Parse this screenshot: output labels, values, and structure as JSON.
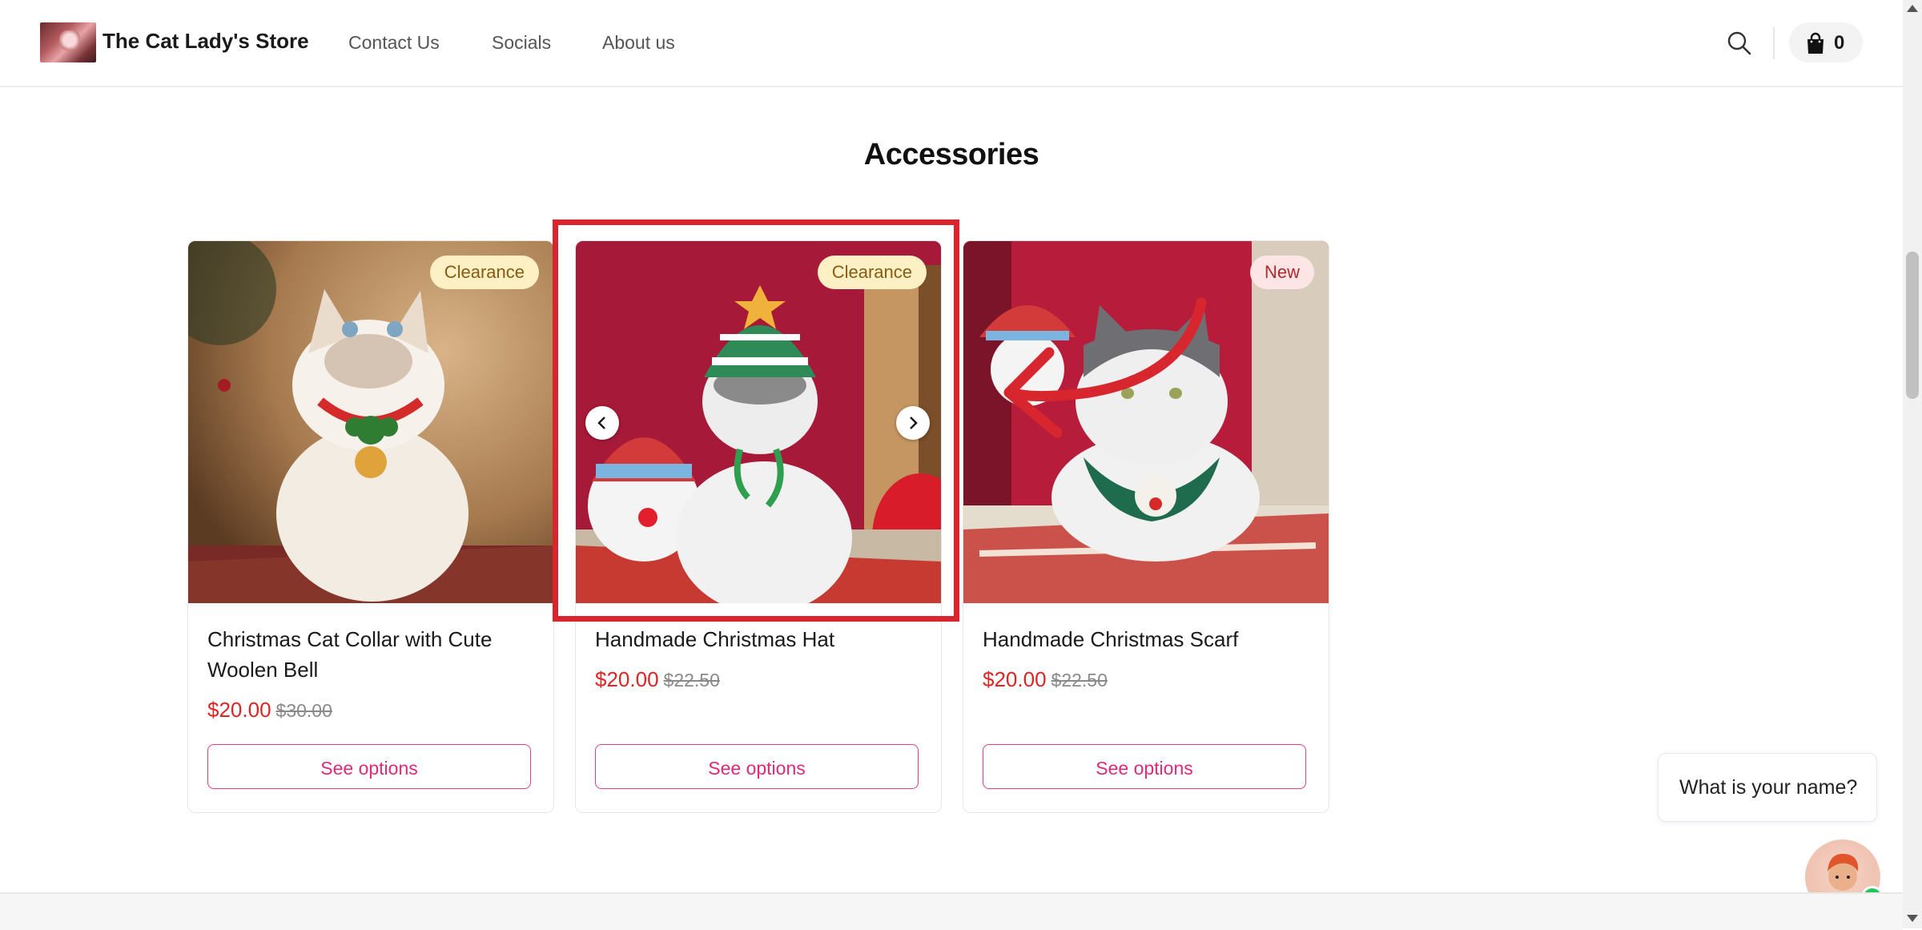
{
  "header": {
    "store_name": "The Cat Lady's Store",
    "nav": [
      "Contact Us",
      "Socials",
      "About us"
    ],
    "cart_count": "0",
    "icons": [
      "search-icon",
      "shopping-bag-icon"
    ]
  },
  "section": {
    "title": "Accessories"
  },
  "products": [
    {
      "badge": "Clearance",
      "title": "Christmas Cat Collar with Cute Woolen Bell",
      "price": "$20.00",
      "old_price": "$30.00",
      "button": "See options"
    },
    {
      "badge": "Clearance",
      "title": "Handmade Christmas Hat",
      "price": "$20.00",
      "old_price": "$22.50",
      "button": "See options"
    },
    {
      "badge": "New",
      "title": "Handmade Christmas Scarf",
      "price": "$20.00",
      "old_price": "$22.50",
      "button": "See options"
    }
  ],
  "chat": {
    "prompt": "What is your name?"
  },
  "colors": {
    "accent_pink": "#e0297a",
    "price_red": "#e02424",
    "highlight_red": "#d7262d",
    "online_green": "#22c55e"
  }
}
